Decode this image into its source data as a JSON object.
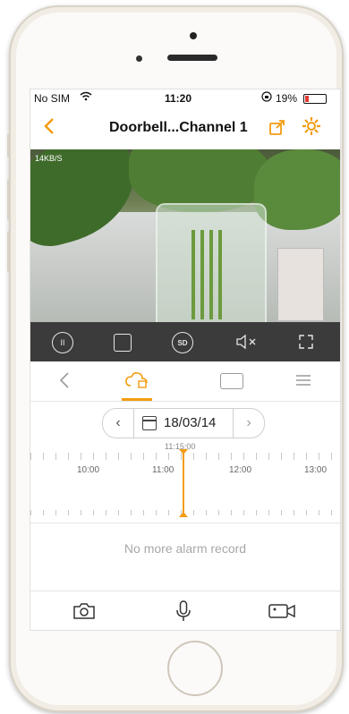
{
  "status_bar": {
    "carrier": "No SIM",
    "time": "11:20",
    "battery_percent": "19%",
    "battery_level": 0.19,
    "battery_color": "#e53935"
  },
  "nav": {
    "back_icon": "chevron-left-icon",
    "title": "Doorbell...Channel 1",
    "share_icon": "share-icon",
    "settings_icon": "gear-icon",
    "accent": "#f39c12"
  },
  "video": {
    "bitrate": "14KB/S"
  },
  "controls": {
    "items": [
      "pause-icon",
      "stop-icon",
      "sd-icon",
      "mute-icon",
      "fullscreen-icon"
    ]
  },
  "tabs": {
    "items": [
      "back-icon",
      "cloud-playback-icon",
      "sd-card-playback-icon",
      "menu-icon"
    ],
    "active": "cloud-playback-icon"
  },
  "date_picker": {
    "date": "18/03/14"
  },
  "timeline": {
    "current_time": "11:15:00",
    "hours": [
      "10:00",
      "11:00",
      "12:00",
      "13:00"
    ]
  },
  "alarm": {
    "message": "No more alarm record"
  },
  "bottom_bar": {
    "items": [
      "camera-icon",
      "microphone-icon",
      "video-record-icon"
    ]
  }
}
